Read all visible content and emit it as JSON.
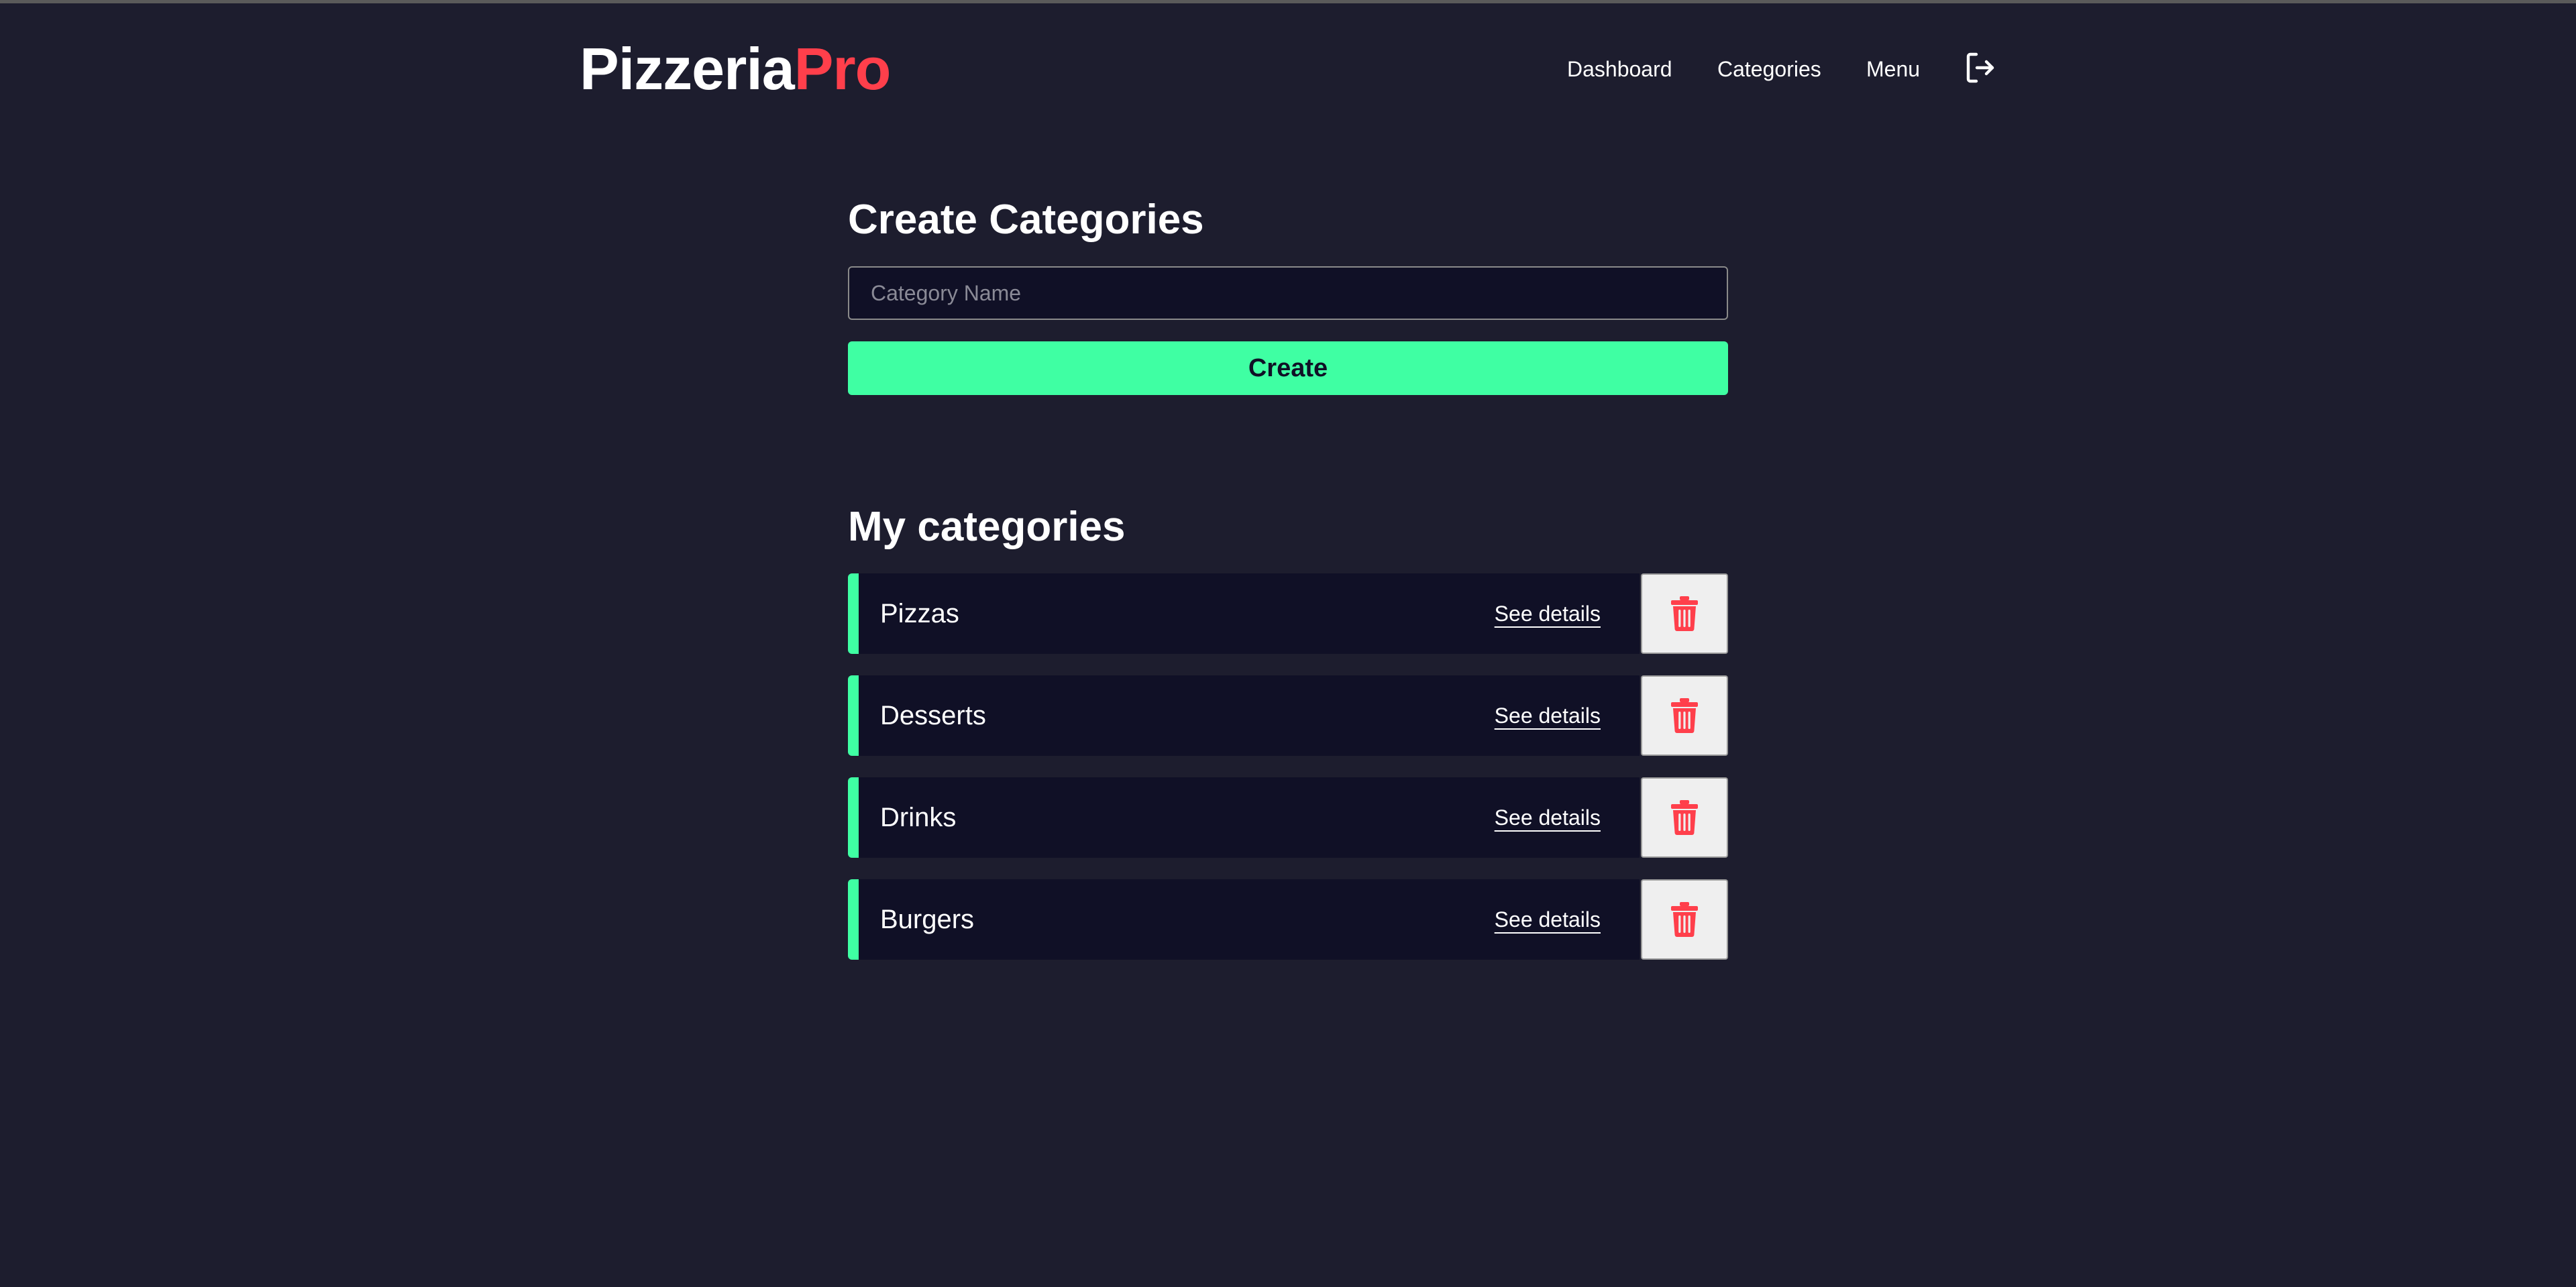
{
  "brand": {
    "name": "Pizzeria",
    "accent": "Pro",
    "accent_color": "#ff3f4b"
  },
  "nav": {
    "dashboard": "Dashboard",
    "categories": "Categories",
    "menu": "Menu",
    "logout_icon": "logout-icon"
  },
  "create": {
    "title": "Create Categories",
    "input_placeholder": "Category Name",
    "input_value": "",
    "button_label": "Create"
  },
  "list": {
    "title": "My categories",
    "details_label": "See details",
    "delete_icon": "trash-icon",
    "items": [
      {
        "name": "Pizzas"
      },
      {
        "name": "Desserts"
      },
      {
        "name": "Drinks"
      },
      {
        "name": "Burgers"
      }
    ]
  },
  "colors": {
    "background": "#1d1d2e",
    "surface": "#101026",
    "primary": "#3fffa3",
    "danger": "#ff3f4b"
  }
}
